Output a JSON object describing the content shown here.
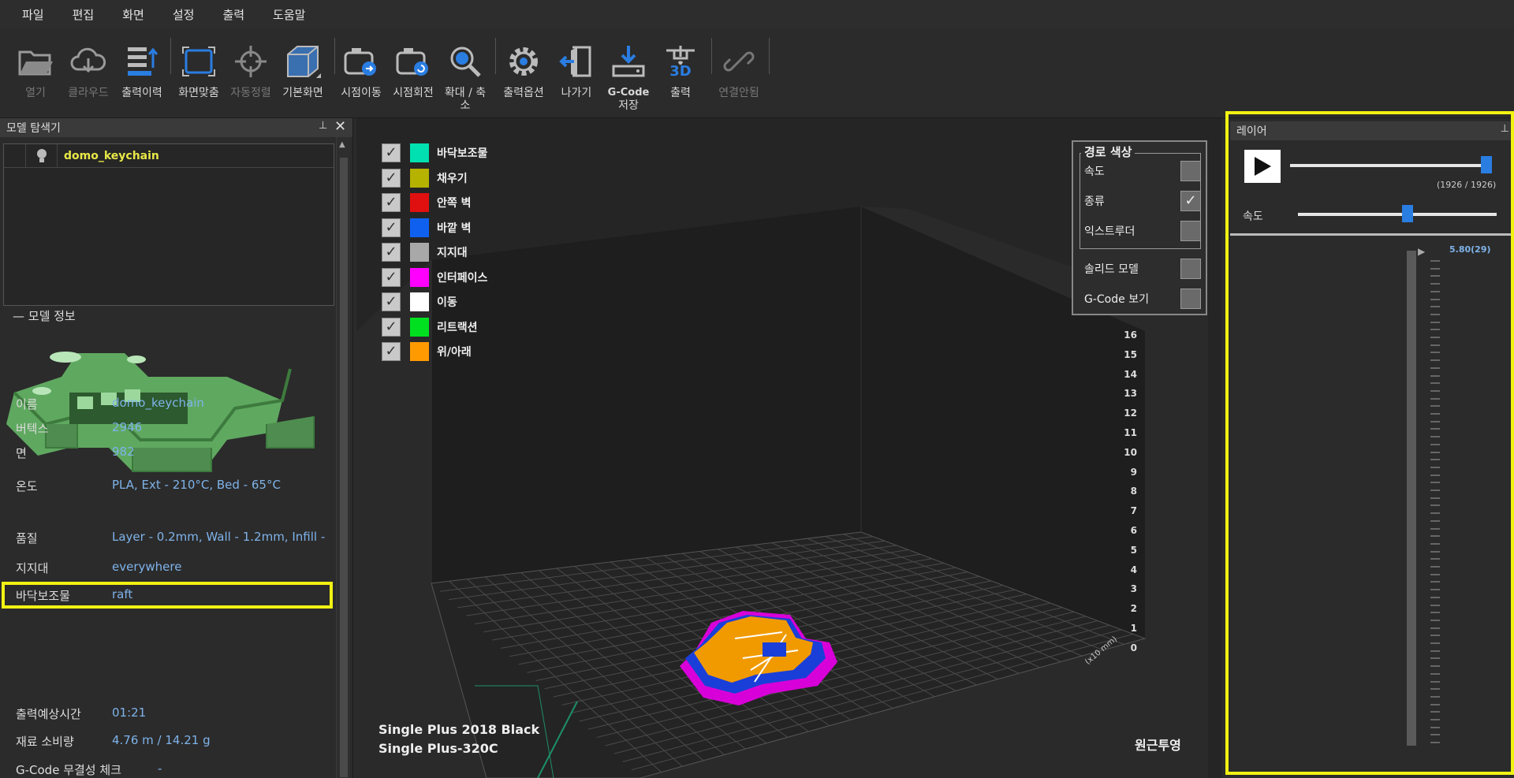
{
  "menu": [
    "파일",
    "편집",
    "화면",
    "설정",
    "출력",
    "도움말"
  ],
  "toolbar": {
    "open": "열기",
    "cloud": "클라우드",
    "history": "출력이력",
    "fit": "화면맞춤",
    "autoalign": "자동정렬",
    "default": "기본화면",
    "move_view": "시점이동",
    "rotate_view": "시점회전",
    "zoom": "확대 / 축소",
    "options": "출력옵션",
    "exit": "나가기",
    "gcode_line1": "G-Code",
    "gcode_line2": "저장",
    "print": "출력",
    "disconnected": "연결안됨",
    "print_badge": "3D"
  },
  "left": {
    "title": "모델 탐색기",
    "model_name": "domo_keychain",
    "info_title": "— 모델 정보",
    "info": [
      {
        "k": "이름",
        "v": "domo_keychain"
      },
      {
        "k": "버텍스",
        "v": "2946"
      },
      {
        "k": "면",
        "v": "982"
      },
      {
        "k": "온도",
        "v": "PLA, Ext - 210°C, Bed - 65°C"
      },
      {
        "k": "품질",
        "v": "Layer - 0.2mm, Wall - 1.2mm, Infill -"
      },
      {
        "k": "지지대",
        "v": "everywhere"
      },
      {
        "k": "바닥보조물",
        "v": "raft"
      },
      {
        "k": "출력예상시간",
        "v": "01:21"
      },
      {
        "k": "재료 소비량",
        "v": "4.76 m / 14.21 g"
      },
      {
        "k": "G-Code 무결성 체크",
        "v": "-"
      }
    ]
  },
  "legend": [
    {
      "label": "바닥보조물",
      "color": "#00e0b0"
    },
    {
      "label": "채우기",
      "color": "#b5b200"
    },
    {
      "label": "안쪽 벽",
      "color": "#e01010"
    },
    {
      "label": "바깥 벽",
      "color": "#1060f0"
    },
    {
      "label": "지지대",
      "color": "#a8a8a8"
    },
    {
      "label": "인터페이스",
      "color": "#ff00ff"
    },
    {
      "label": "이동",
      "color": "#ffffff"
    },
    {
      "label": "리트랙션",
      "color": "#00e020"
    },
    {
      "label": "위/아래",
      "color": "#ff9a00"
    }
  ],
  "path_color": {
    "title": "경로 색상",
    "speed": "속도",
    "type": "종류",
    "extruder": "익스트루더",
    "solid": "솔리드 모델",
    "gcode": "G-Code 보기",
    "check_mark": "✓"
  },
  "viewport": {
    "printer1": "Single Plus 2018 Black",
    "printer2": "Single Plus-320C",
    "projection": "원근투영",
    "z_ticks": [
      "16",
      "15",
      "14",
      "13",
      "12",
      "11",
      "10",
      "9",
      "8",
      "7",
      "6",
      "5",
      "4",
      "3",
      "2",
      "1",
      "0"
    ],
    "x_unit": "(x10 mm)"
  },
  "layer": {
    "title": "레이어",
    "counter": "(1926 / 1926)",
    "speed_label": "속도",
    "layer_value": "5.80(29)",
    "play_progress": 1.0,
    "speed_level": 0.55
  }
}
